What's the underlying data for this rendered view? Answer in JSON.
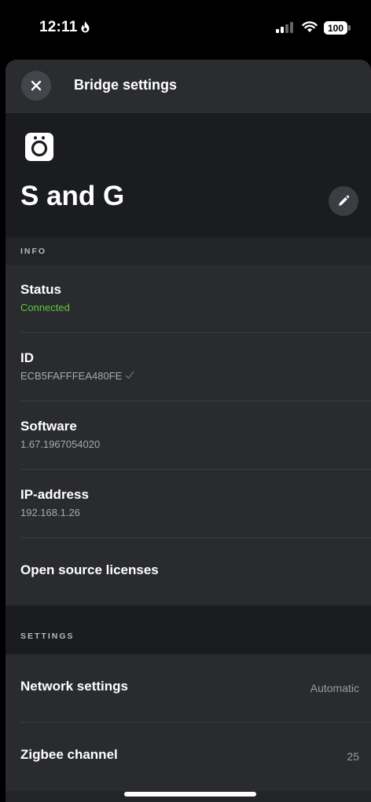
{
  "status_bar": {
    "time": "12:11",
    "battery": "100"
  },
  "header": {
    "title": "Bridge settings"
  },
  "bridge": {
    "name": "S and G"
  },
  "info_section": {
    "label": "INFO",
    "rows": [
      {
        "title": "Status",
        "value": "Connected",
        "value_color": "#5fc83a"
      },
      {
        "title": "ID",
        "value": "ECB5FAFFFEA480FE"
      },
      {
        "title": "Software",
        "value": "1.67.1967054020"
      },
      {
        "title": "IP-address",
        "value": "192.168.1.26"
      },
      {
        "title": "Open source licenses"
      }
    ]
  },
  "settings_section": {
    "label": "SETTINGS",
    "rows": [
      {
        "title": "Network settings",
        "value": "Automatic"
      },
      {
        "title": "Zigbee channel",
        "value": "25"
      }
    ]
  },
  "colors": {
    "sheet_bg": "#232428",
    "hero_bg": "#1b1c1f",
    "row_bg": "#2a2b2f",
    "connected_green": "#5fc83a"
  }
}
